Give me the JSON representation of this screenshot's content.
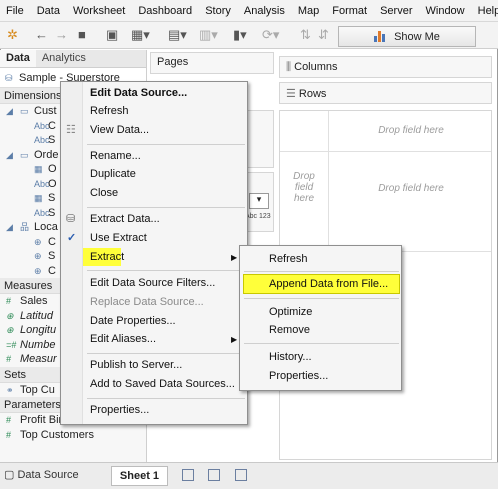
{
  "menubar": [
    "File",
    "Data",
    "Worksheet",
    "Dashboard",
    "Story",
    "Analysis",
    "Map",
    "Format",
    "Server",
    "Window",
    "Help"
  ],
  "toolbar": {
    "show_me": "Show Me"
  },
  "left_pane": {
    "tab_data": "Data",
    "tab_analytics": "Analytics",
    "source": "Sample - Superstore",
    "dimensions_header": "Dimensions",
    "dimension_rows": [
      "Cust",
      "C",
      "S",
      "Orde",
      "O",
      "O",
      "S",
      "S",
      "Loca",
      "C",
      "S",
      "C"
    ],
    "measures_header": "Measures",
    "measure_rows": [
      "Sales",
      "Latitud",
      "Longitu",
      "Numbe",
      "Measur"
    ],
    "sets_header": "Sets",
    "set_rows": [
      "Top Cu"
    ],
    "parameters_header": "Parameters",
    "parameter_rows": [
      "Profit Bin Size",
      "Top Customers"
    ]
  },
  "shelves": {
    "pages": "Pages",
    "columns": "Columns",
    "rows": "Rows",
    "drop_here_1": "Drop field here",
    "drop_here_2": "Drop field here",
    "drop_here_3": "Drop field here",
    "mark_text": "Abc 123"
  },
  "context_menu": {
    "items": [
      {
        "label": "Edit Data Source...",
        "bold": true
      },
      {
        "label": "Refresh"
      },
      {
        "label": "View Data..."
      },
      {
        "label": "Rename..."
      },
      {
        "label": "Duplicate"
      },
      {
        "label": "Close"
      },
      {
        "label": "Extract Data..."
      },
      {
        "label": "Use Extract",
        "checked": true
      },
      {
        "label": "Extract",
        "submenu": true,
        "highlighted": true
      },
      {
        "label": "Edit Data Source Filters..."
      },
      {
        "label": "Replace Data Source...",
        "disabled": true
      },
      {
        "label": "Date Properties..."
      },
      {
        "label": "Edit Aliases...",
        "submenu": true
      },
      {
        "label": "Publish to Server..."
      },
      {
        "label": "Add to Saved Data Sources..."
      },
      {
        "label": "Properties..."
      }
    ]
  },
  "submenu": {
    "items": [
      {
        "label": "Refresh"
      },
      {
        "label": "Append Data from File...",
        "highlighted": true
      },
      {
        "label": "Optimize"
      },
      {
        "label": "Remove"
      },
      {
        "label": "History..."
      },
      {
        "label": "Properties..."
      }
    ]
  },
  "bottom_tabs": {
    "data_source": "Data Source",
    "sheet": "Sheet 1"
  },
  "colors": {
    "highlight": "#ffff3a",
    "accent": "#4a76b8"
  }
}
